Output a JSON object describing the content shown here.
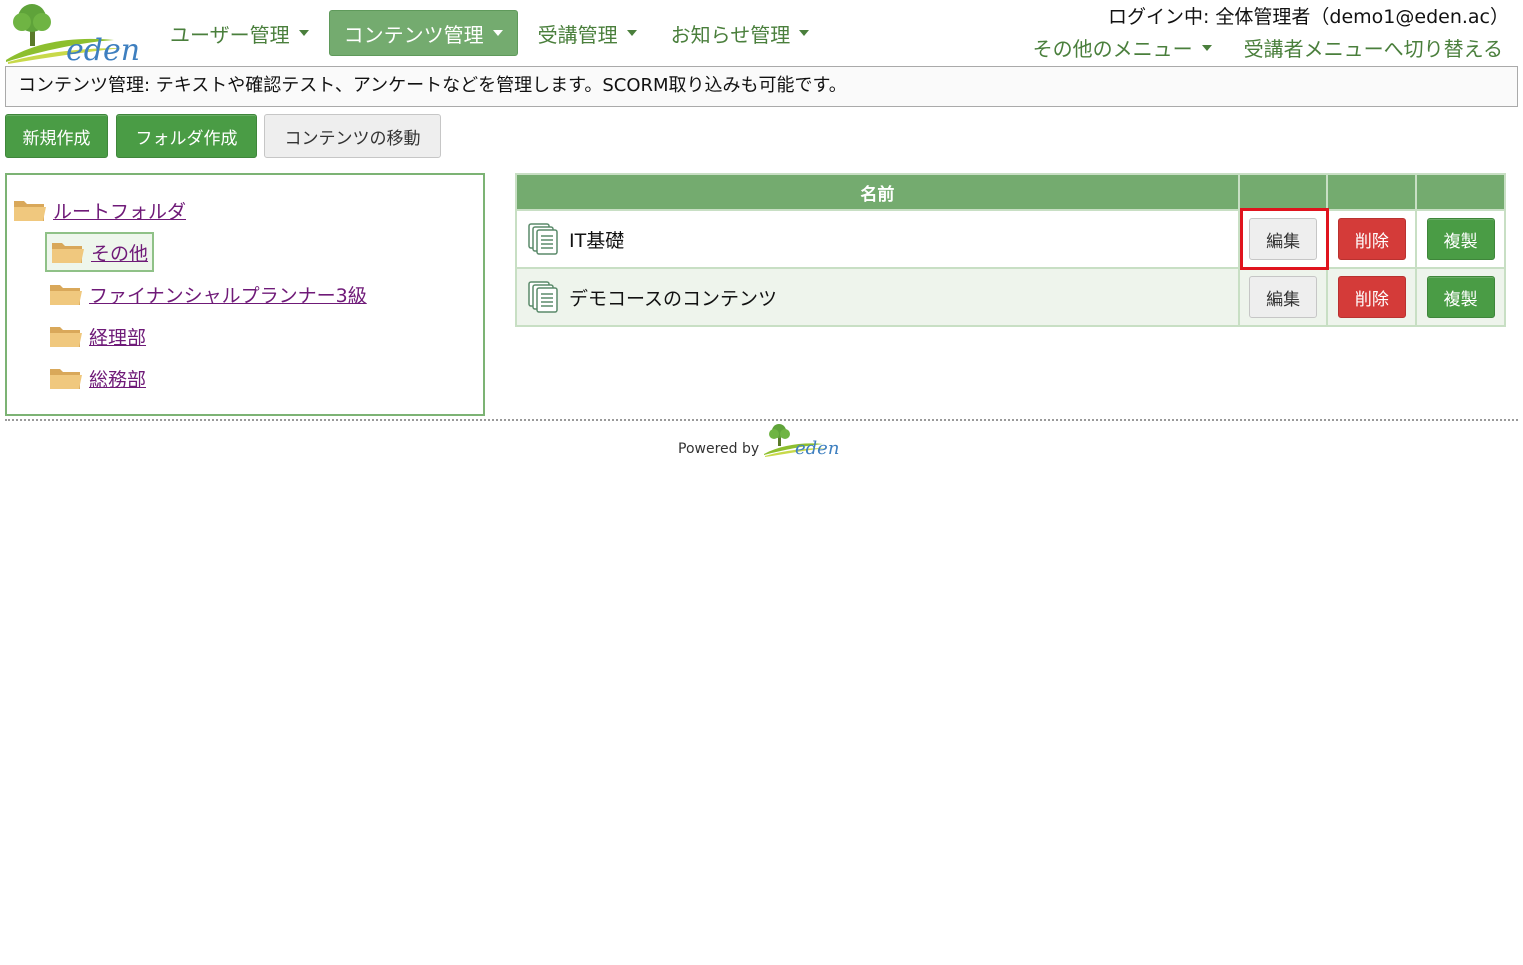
{
  "header": {
    "logo_text": "eden",
    "nav": [
      {
        "label": "ユーザー管理",
        "active": false
      },
      {
        "label": "コンテンツ管理",
        "active": true
      },
      {
        "label": "受講管理",
        "active": false
      },
      {
        "label": "お知らせ管理",
        "active": false
      }
    ],
    "login_info": "ログイン中: 全体管理者（demo1@eden.ac）",
    "other_menu": "その他のメニュー",
    "switch_menu": "受講者メニューへ切り替える"
  },
  "description": "コンテンツ管理: テキストや確認テスト、アンケートなどを管理します。SCORM取り込みも可能です。",
  "toolbar": {
    "new_label": "新規作成",
    "folder_label": "フォルダ作成",
    "move_label": "コンテンツの移動"
  },
  "tree": {
    "root": "ルートフォルダ",
    "children": [
      {
        "label": "その他",
        "selected": true
      },
      {
        "label": "ファイナンシャルプランナー3級",
        "selected": false
      },
      {
        "label": "経理部",
        "selected": false
      },
      {
        "label": "総務部",
        "selected": false
      }
    ]
  },
  "table": {
    "header_name": "名前",
    "rows": [
      {
        "name": "IT基礎",
        "edit": "編集",
        "delete": "削除",
        "copy": "複製"
      },
      {
        "name": "デモコースのコンテンツ",
        "edit": "編集",
        "delete": "削除",
        "copy": "複製"
      }
    ]
  },
  "footer": {
    "powered_by": "Powered by",
    "logo_text": "eden"
  },
  "colors": {
    "brand_green": "#4a9c45",
    "header_green": "#74ab6f",
    "danger_red": "#d43b39",
    "highlight_red": "#e0141e",
    "link_purple": "#6f1a78"
  },
  "icons": {
    "logo": "eden-tree-logo",
    "folder": "folder-icon",
    "document": "document-stack-icon",
    "caret": "caret-down-icon"
  }
}
